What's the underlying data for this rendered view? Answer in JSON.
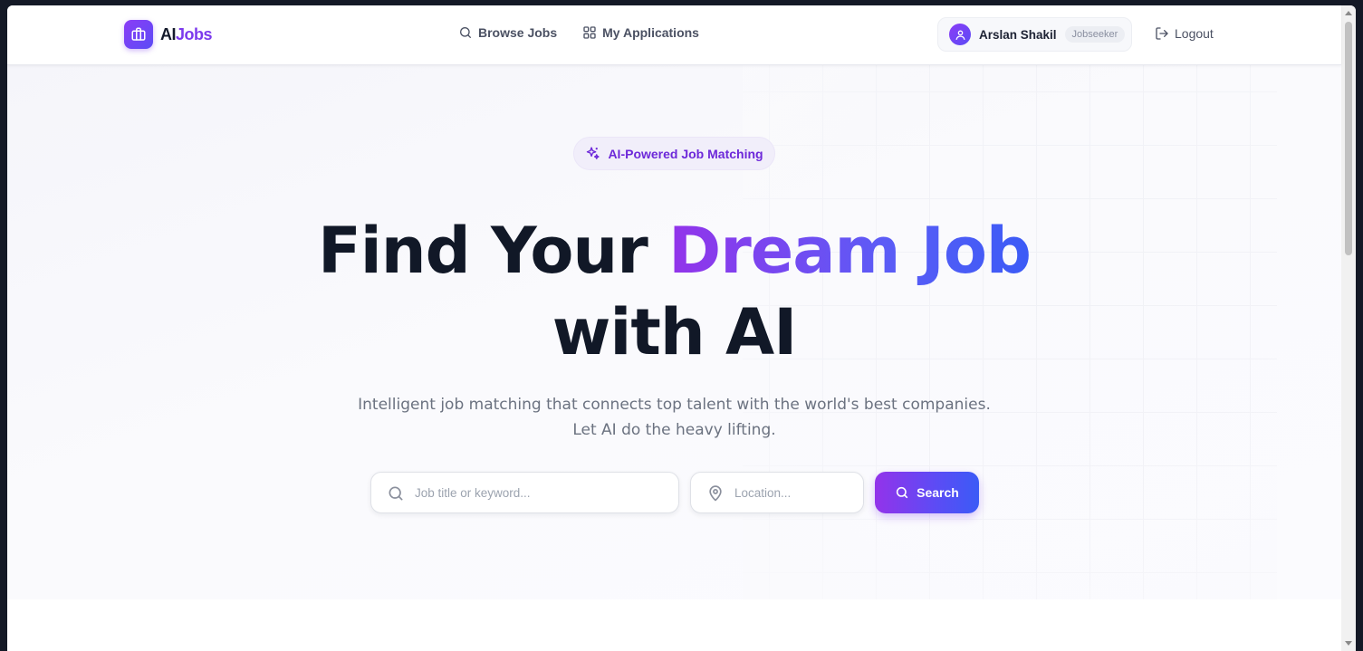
{
  "brand": {
    "logo_part1": "AI",
    "logo_part2": "Jobs",
    "logo_icon": "briefcase-icon"
  },
  "nav": {
    "browse_jobs": {
      "label": "Browse Jobs",
      "icon": "search-icon"
    },
    "my_applications": {
      "label": "My Applications",
      "icon": "grid-icon"
    }
  },
  "user": {
    "name": "Arslan Shakil",
    "role": "Jobseeker",
    "avatar_icon": "user-icon"
  },
  "logout": {
    "label": "Logout",
    "icon": "logout-icon"
  },
  "hero": {
    "badge": "AI-Powered Job Matching",
    "badge_icon": "sparkles-icon",
    "headline_part1": "Find Your ",
    "headline_gradient": "Dream Job",
    "headline_part2": "with AI",
    "subtitle_line1": "Intelligent job matching that connects top talent with the world's best companies.",
    "subtitle_line2": "Let AI do the heavy lifting."
  },
  "search": {
    "keyword_placeholder": "Job title or keyword...",
    "keyword_value": "",
    "location_placeholder": "Location...",
    "location_value": "",
    "button_label": "Search"
  },
  "colors": {
    "accent_purple": "#7c3aed",
    "accent_blue": "#3b5bf6",
    "heading": "#111827",
    "text_muted": "#6b7280",
    "page_frame": "#141926"
  }
}
